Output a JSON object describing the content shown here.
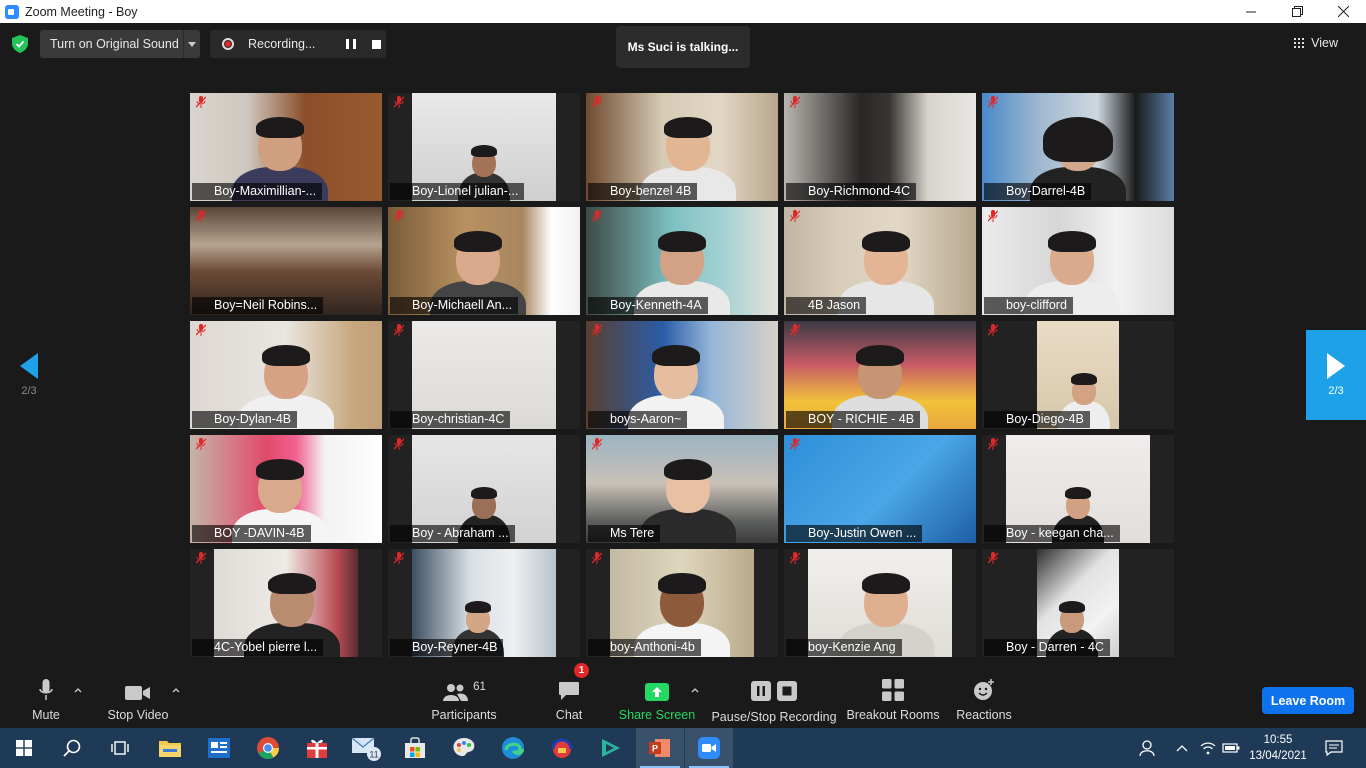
{
  "window": {
    "title": "Zoom Meeting - Boy"
  },
  "topbar": {
    "original_sound_label": "Turn on Original Sound",
    "recording_label": "Recording...",
    "talking_label": "Ms Suci is talking...",
    "view_label": "View"
  },
  "gallery": {
    "page_indicator": "2/3",
    "tiles": [
      {
        "name": "Boy-Maximillian-..."
      },
      {
        "name": "Boy-Lionel julian-..."
      },
      {
        "name": "Boy-benzel 4B"
      },
      {
        "name": "Boy-Richmond-4C"
      },
      {
        "name": "Boy-Darrel-4B"
      },
      {
        "name": "Boy=Neil Robins..."
      },
      {
        "name": "Boy-Michaell An..."
      },
      {
        "name": "Boy-Kenneth-4A"
      },
      {
        "name": "4B Jason"
      },
      {
        "name": "boy-clifford"
      },
      {
        "name": "Boy-Dylan-4B"
      },
      {
        "name": "Boy-christian-4C"
      },
      {
        "name": "boys-Aaron~"
      },
      {
        "name": "BOY - RICHIE - 4B"
      },
      {
        "name": "Boy-Diego-4B"
      },
      {
        "name": "BOY -DAVIN-4B"
      },
      {
        "name": "Boy - Abraham ..."
      },
      {
        "name": "Ms Tere"
      },
      {
        "name": "Boy-Justin Owen ..."
      },
      {
        "name": "Boy - keegan cha..."
      },
      {
        "name": "4C-Yobel pierre l..."
      },
      {
        "name": "Boy-Reyner-4B"
      },
      {
        "name": "boy-Anthoni-4b"
      },
      {
        "name": "boy-Kenzie Ang"
      },
      {
        "name": "Boy - Darren - 4C"
      }
    ]
  },
  "toolbar": {
    "mute_label": "Mute",
    "stop_video_label": "Stop Video",
    "participants_label": "Participants",
    "participants_count": "61",
    "chat_label": "Chat",
    "chat_badge": "1",
    "share_screen_label": "Share Screen",
    "pause_stop_recording_label": "Pause/Stop Recording",
    "breakout_rooms_label": "Breakout Rooms",
    "reactions_label": "Reactions",
    "leave_label": "Leave Room"
  },
  "taskbar": {
    "mail_badge": "11",
    "time": "10:55",
    "date": "13/04/2021"
  },
  "colors": {
    "share_green": "#23d962",
    "leave_blue": "#0e72ed",
    "next_page_blue": "#1da2e9",
    "taskbar": "#1f3a56",
    "muted_red": "#e02828"
  }
}
